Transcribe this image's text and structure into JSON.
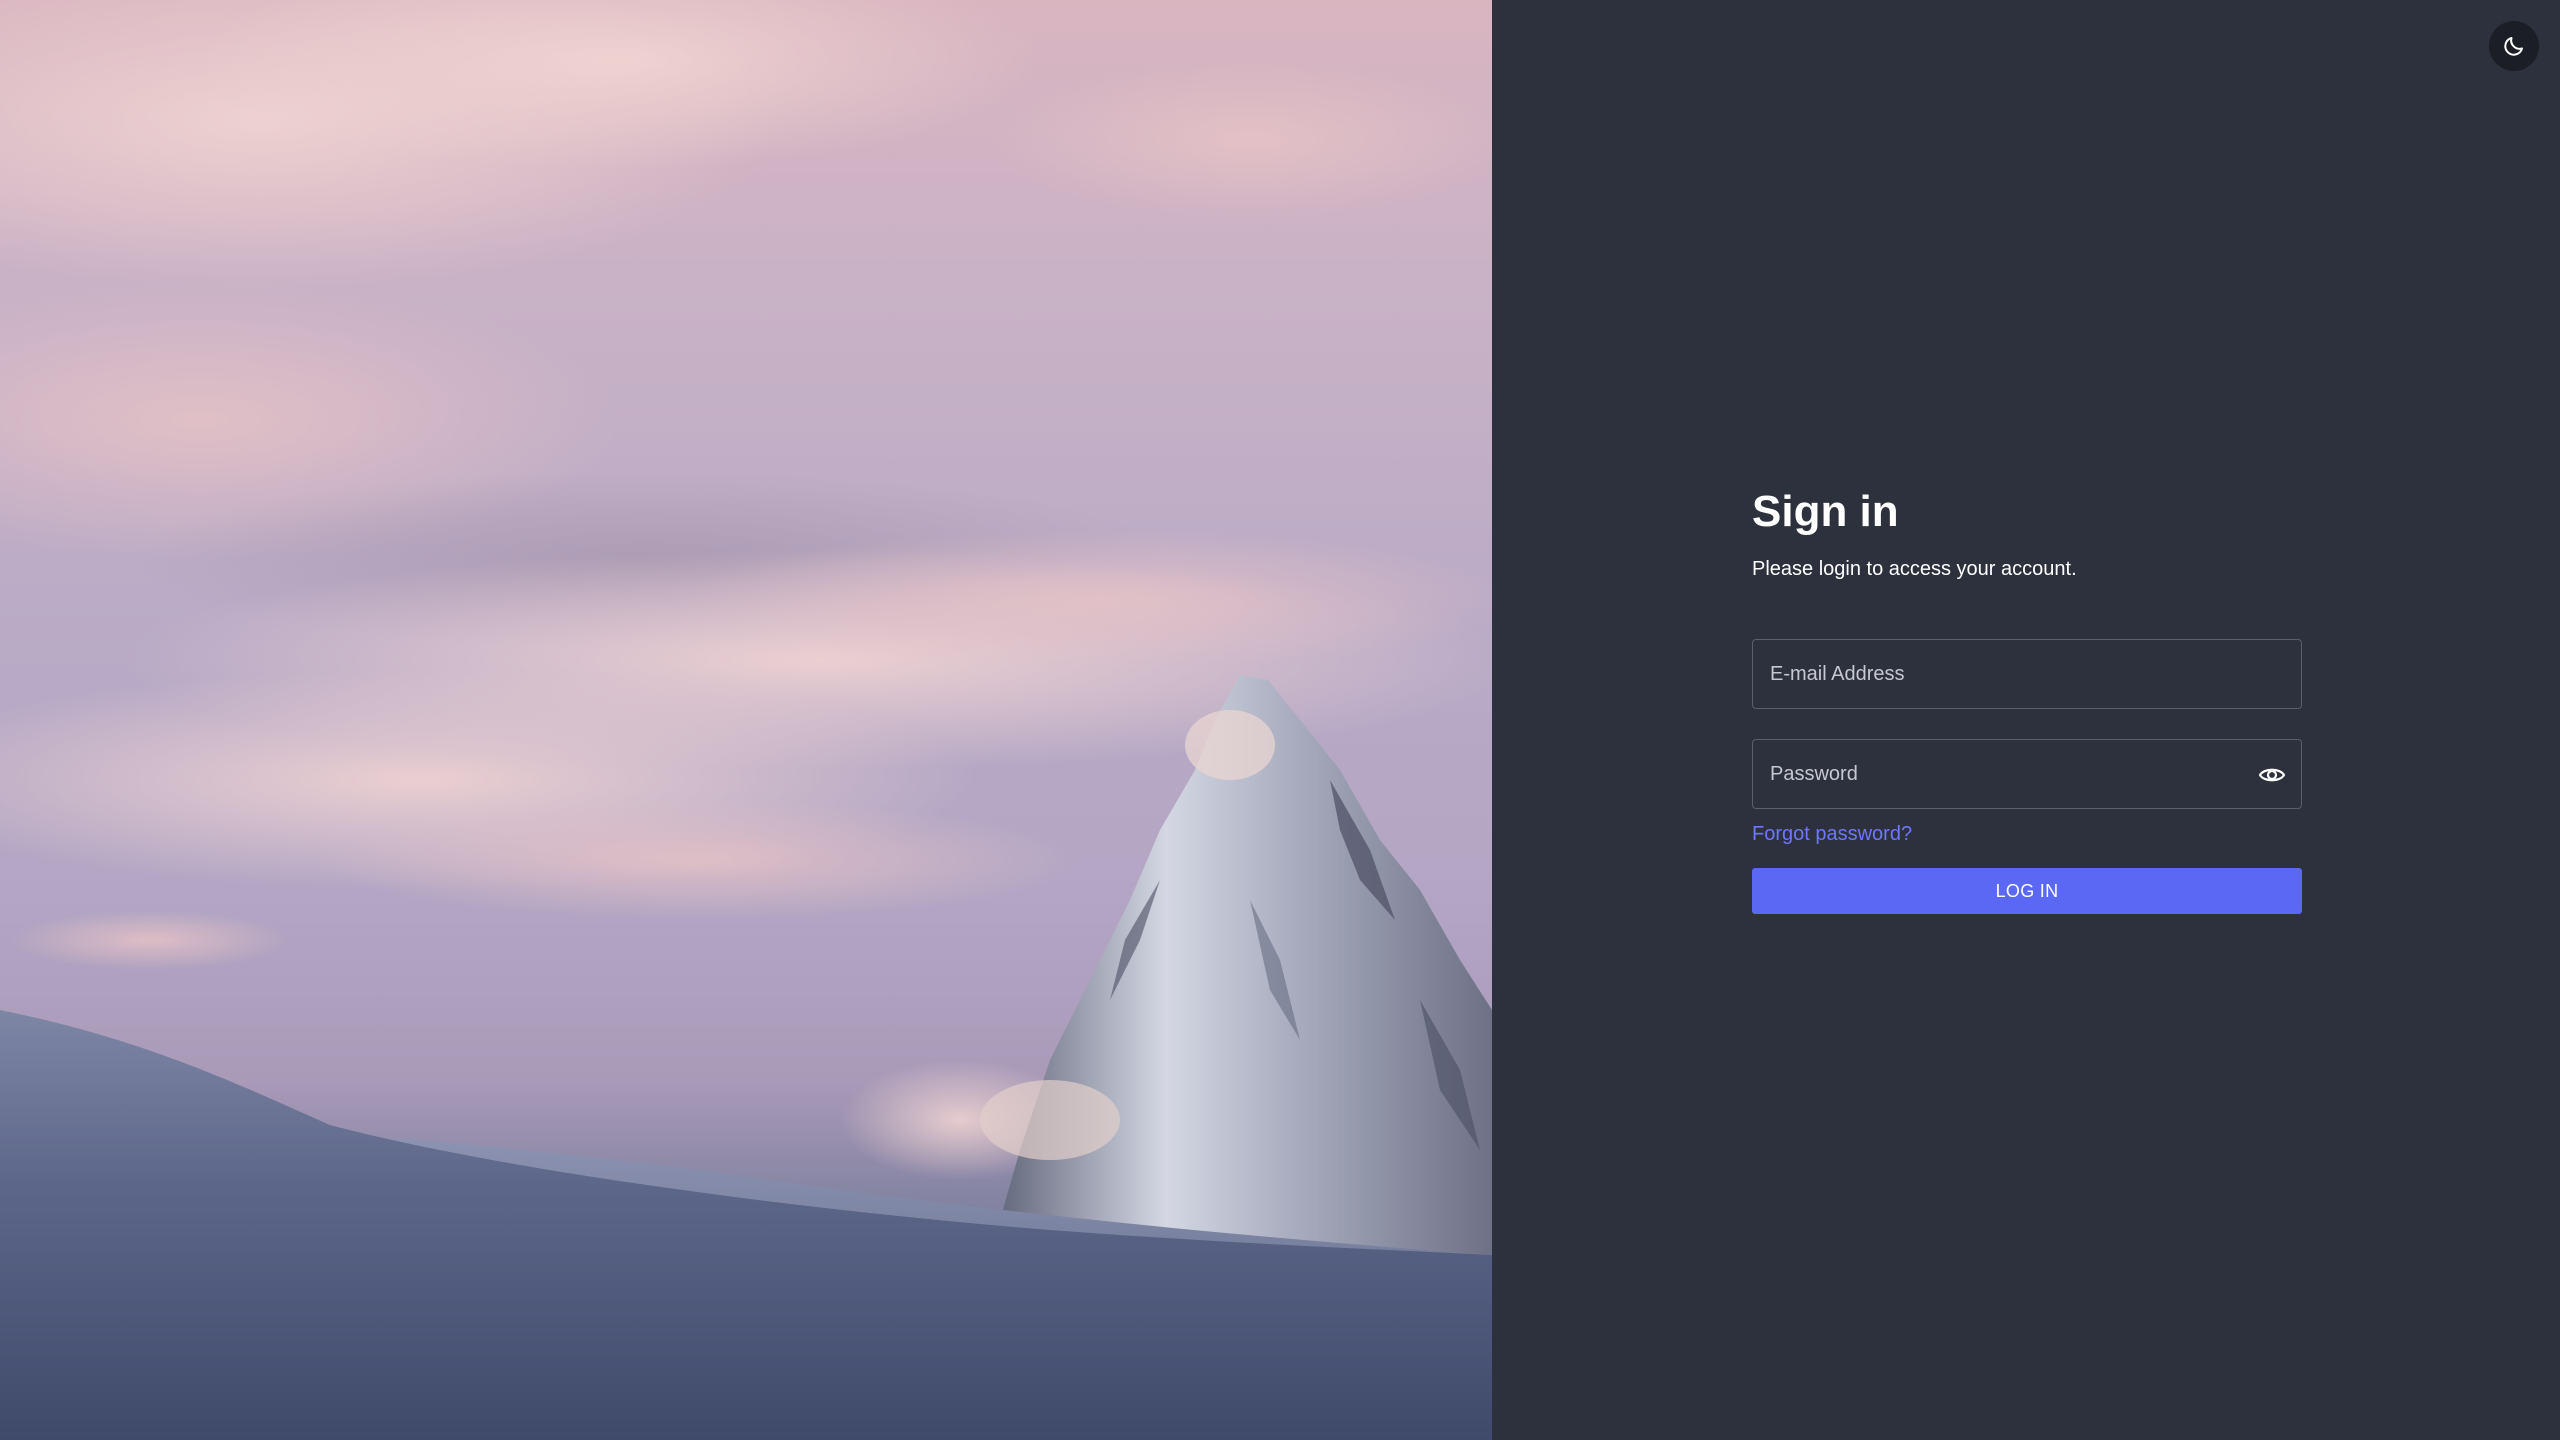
{
  "hero": {
    "image": "mountain-peak-at-sunset-photo"
  },
  "header": {
    "theme_toggle_icon": "moon-icon"
  },
  "login": {
    "title": "Sign in",
    "subtitle": "Please login to access your account.",
    "email_placeholder": "E-mail Address",
    "email_value": "",
    "password_placeholder": "Password",
    "password_value": "",
    "password_toggle_icon": "eye-icon",
    "forgot_password_label": "Forgot password?",
    "submit_label": "LOG IN"
  },
  "colors": {
    "panel_background": "#2d303d",
    "accent": "#5a68f3",
    "link": "#6b78ff"
  }
}
